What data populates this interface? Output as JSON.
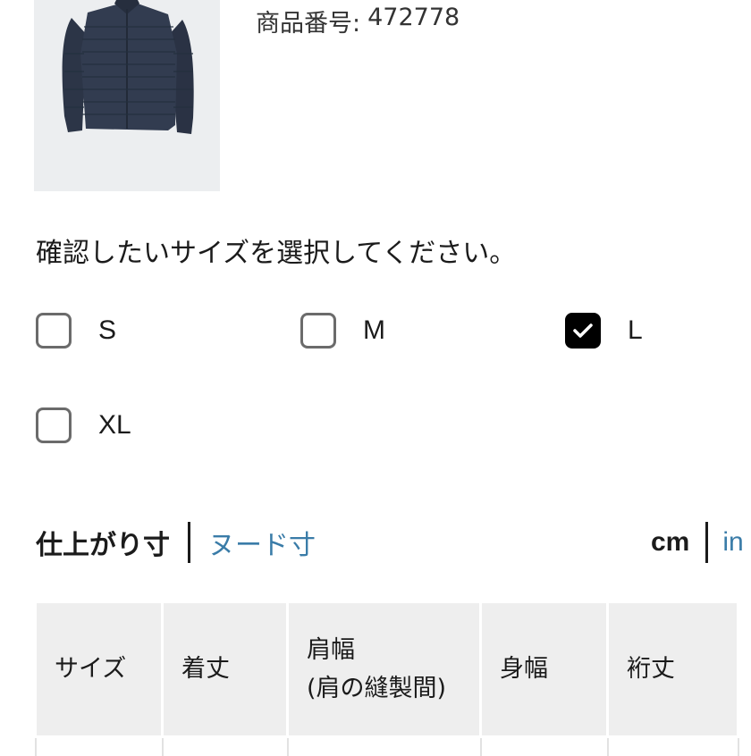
{
  "product": {
    "code_label": "商品番号:",
    "code_value": "472778"
  },
  "size_selector": {
    "instruction": "確認したいサイズを選択してください。",
    "options": [
      {
        "label": "S",
        "checked": false
      },
      {
        "label": "M",
        "checked": false
      },
      {
        "label": "L",
        "checked": true
      },
      {
        "label": "XL",
        "checked": false
      }
    ]
  },
  "measurement": {
    "tabs": [
      "仕上がり寸",
      "ヌード寸"
    ],
    "active_tab": "仕上がり寸",
    "units": [
      "cm",
      "in"
    ],
    "active_unit": "cm"
  },
  "size_table": {
    "headers": [
      "サイズ",
      "着丈",
      "肩幅",
      "(肩の縫製間)",
      "身幅",
      "裄丈"
    ]
  },
  "colors": {
    "link": "#3a7ca8",
    "header_bg": "#eeeeee",
    "checkbox_checked": "#000000"
  }
}
